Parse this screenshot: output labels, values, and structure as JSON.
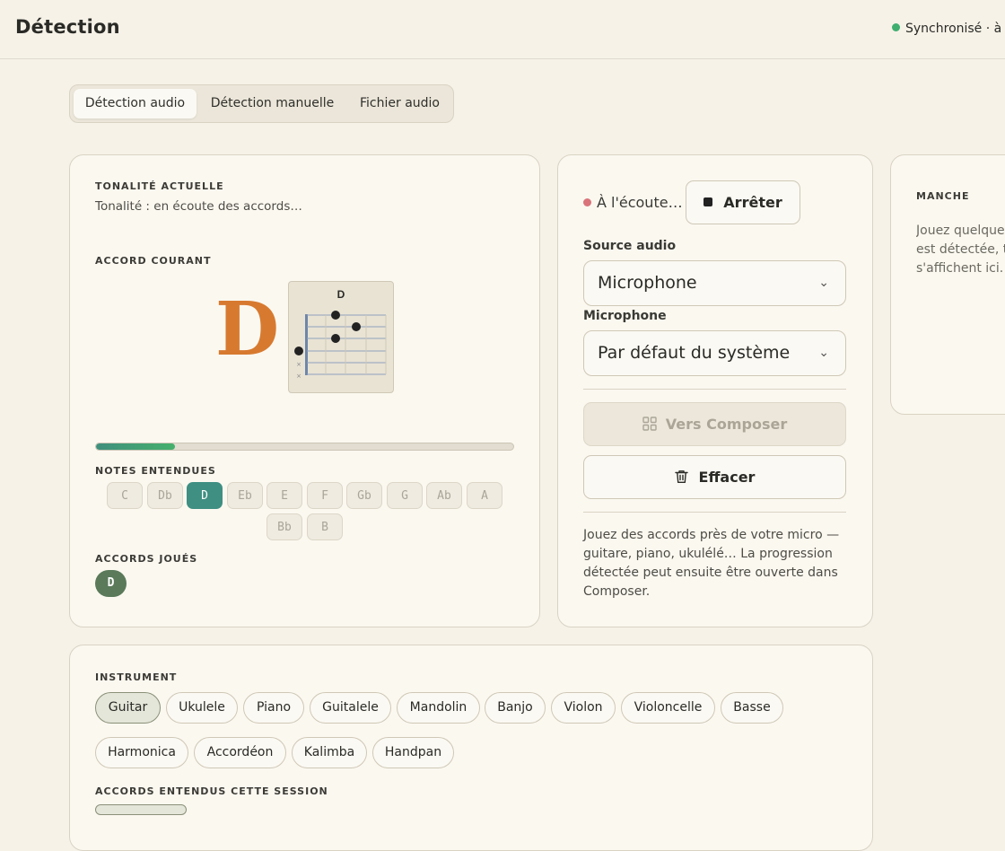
{
  "header": {
    "title": "Détection",
    "sync_status": "Synchronisé · à l'",
    "sync_color": "#3fae6f"
  },
  "tabs": [
    {
      "label": "Détection audio",
      "active": true
    },
    {
      "label": "Détection manuelle",
      "active": false
    },
    {
      "label": "Fichier audio",
      "active": false
    }
  ],
  "detection": {
    "key_label": "TONALITÉ ACTUELLE",
    "key_text": "Tonalité : en écoute des accords…",
    "chord_label": "ACCORD COURANT",
    "current_chord": "D",
    "diagram_title": "D",
    "diagram_mute_marks": [
      "×",
      "×"
    ],
    "confidence": 0.19,
    "notes_label": "NOTES ENTENDUES",
    "notes": [
      {
        "name": "C",
        "active": false
      },
      {
        "name": "Db",
        "active": false
      },
      {
        "name": "D",
        "active": true
      },
      {
        "name": "Eb",
        "active": false
      },
      {
        "name": "E",
        "active": false
      },
      {
        "name": "F",
        "active": false
      },
      {
        "name": "Gb",
        "active": false
      },
      {
        "name": "G",
        "active": false
      },
      {
        "name": "Ab",
        "active": false
      },
      {
        "name": "A",
        "active": false
      },
      {
        "name": "Bb",
        "active": false
      },
      {
        "name": "B",
        "active": false
      }
    ],
    "played_label": "ACCORDS JOUÉS",
    "played_chords": [
      "D"
    ]
  },
  "controls": {
    "listening_status": "À l'écoute…",
    "stop_label": "Arrêter",
    "source_label": "Source audio",
    "source_value": "Microphone",
    "mic_label": "Microphone",
    "mic_value": "Par défaut du système",
    "composer_label": "Vers Composer",
    "clear_label": "Effacer",
    "help_lines": [
      "Jouez des accords près de votre micro —",
      "guitare, piano, ukulélé… La progression",
      "détectée peut ensuite être ouverte dans",
      "Composer."
    ]
  },
  "neck": {
    "label": "MANCHE",
    "lines": [
      "Jouez quelques",
      "est détectée, to",
      "s'affichent ici."
    ]
  },
  "instrument": {
    "label": "INSTRUMENT",
    "options": [
      "Guitar",
      "Ukulele",
      "Piano",
      "Guitalele",
      "Mandolin",
      "Banjo",
      "Violon",
      "Violoncelle",
      "Basse",
      "Harmonica",
      "Accordéon",
      "Kalimba",
      "Handpan"
    ],
    "selected": "Guitar",
    "session_label": "ACCORDS ENTENDUS CETTE SESSION"
  }
}
